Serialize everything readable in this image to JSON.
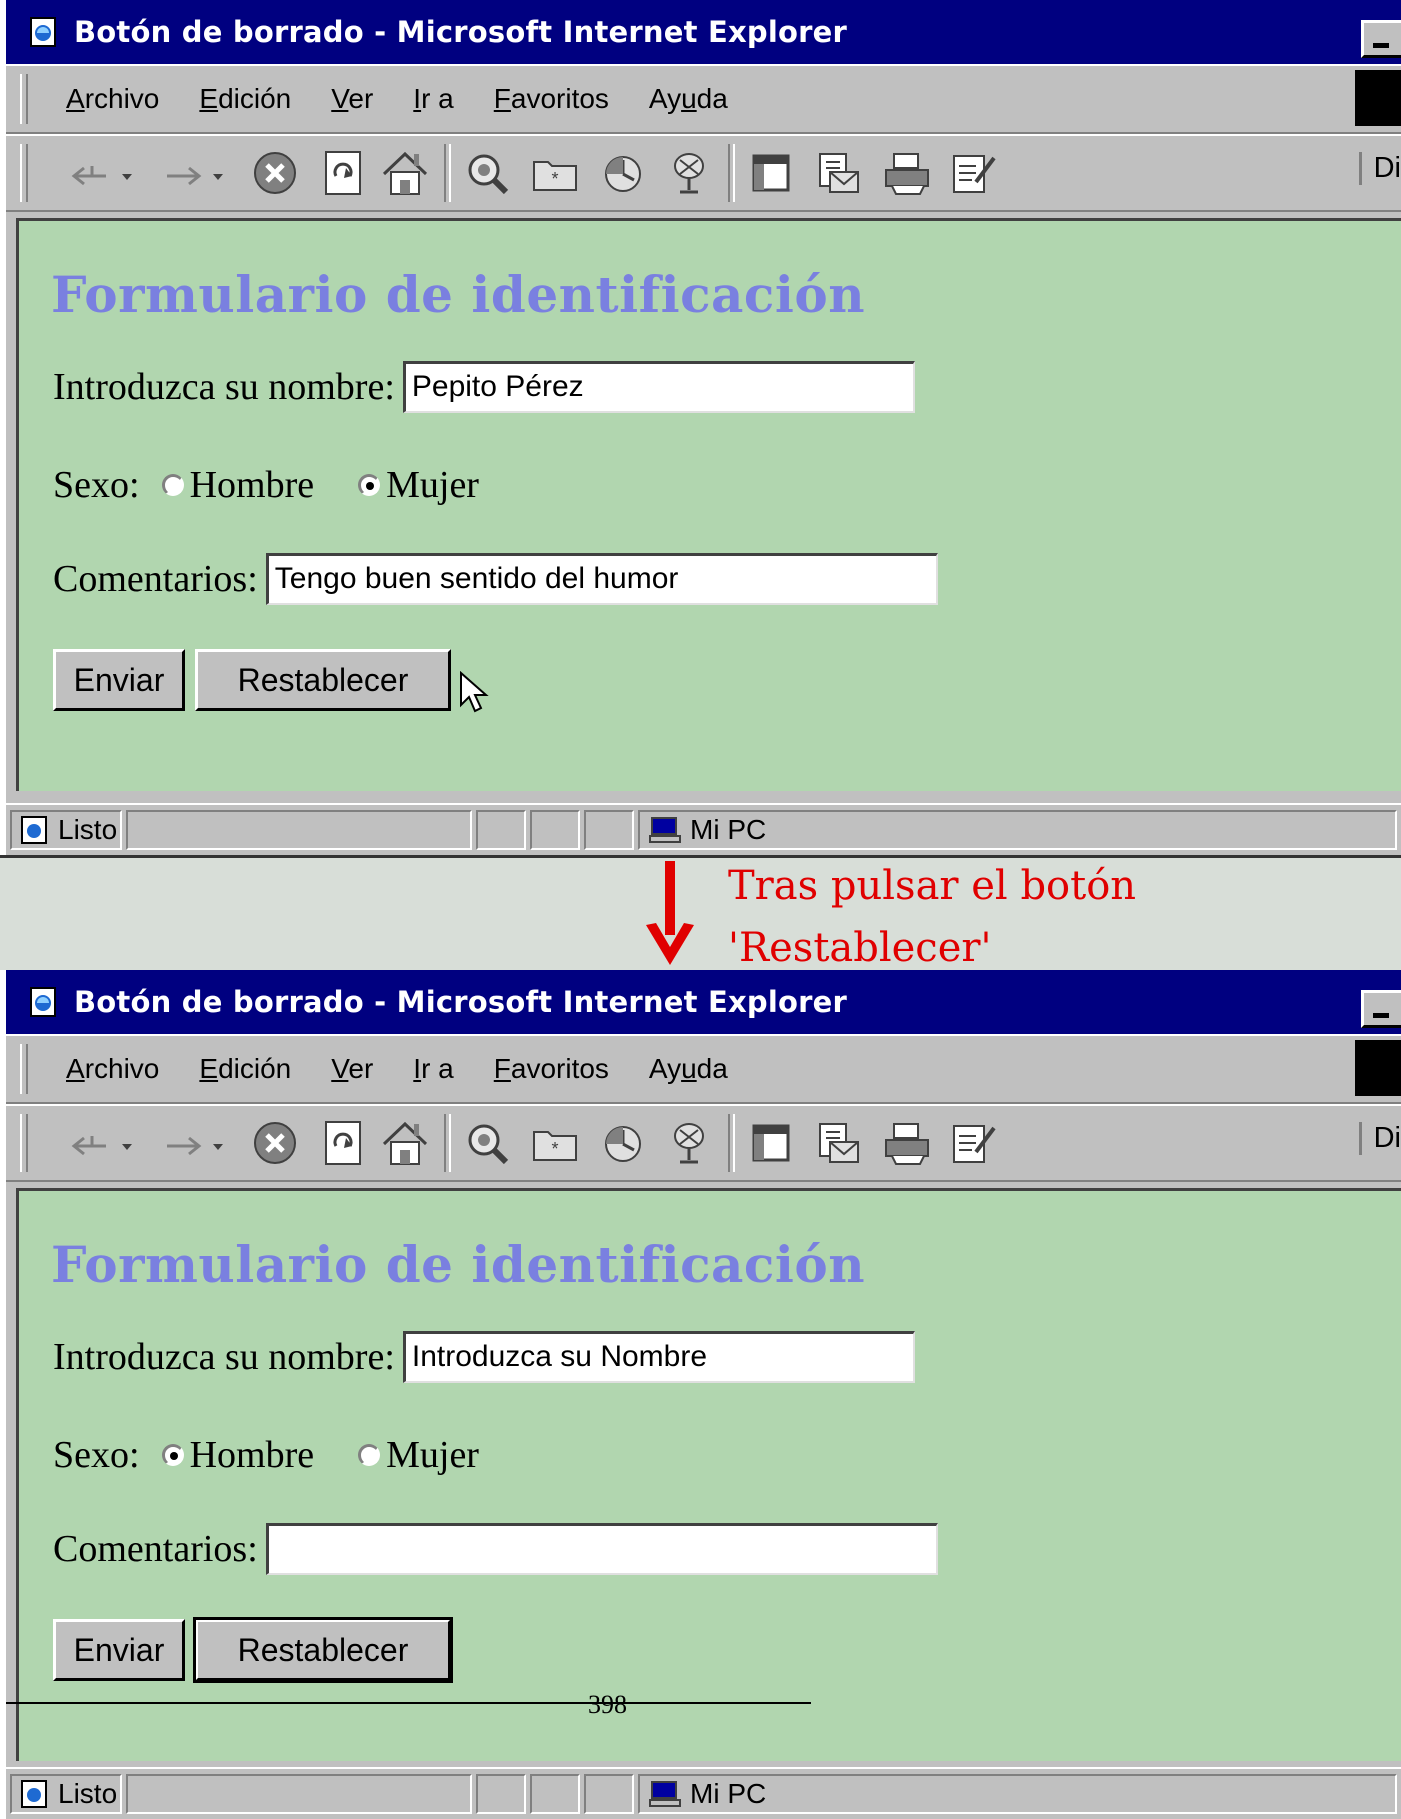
{
  "windows": [
    {
      "title": "Botón de borrado - Microsoft Internet Explorer",
      "menu": {
        "items": [
          {
            "pre": "",
            "accel": "A",
            "post": "rchivo"
          },
          {
            "pre": "",
            "accel": "E",
            "post": "dición"
          },
          {
            "pre": "",
            "accel": "V",
            "post": "er"
          },
          {
            "pre": "",
            "accel": "I",
            "post": "r a"
          },
          {
            "pre": "",
            "accel": "F",
            "post": "avoritos"
          },
          {
            "pre": "Ay",
            "accel": "u",
            "post": "da"
          }
        ]
      },
      "toolbar": {
        "address_label": "Di"
      },
      "form": {
        "heading": "Formulario de identificación",
        "name_label": "Introduzca su nombre:",
        "name_value": "Pepito Pérez",
        "sex_label": "Sexo:",
        "sex_options": [
          "Hombre",
          "Mujer"
        ],
        "sex_selected": "Mujer",
        "comments_label": "Comentarios:",
        "comments_value": "Tengo buen sentido del humor",
        "submit_label": "Enviar",
        "reset_label": "Restablecer"
      },
      "status": {
        "text": "Listo",
        "zone": "Mi PC"
      }
    },
    {
      "title": "Botón de borrado - Microsoft Internet Explorer",
      "menu": {
        "items": [
          {
            "pre": "",
            "accel": "A",
            "post": "rchivo"
          },
          {
            "pre": "",
            "accel": "E",
            "post": "dición"
          },
          {
            "pre": "",
            "accel": "V",
            "post": "er"
          },
          {
            "pre": "",
            "accel": "I",
            "post": "r a"
          },
          {
            "pre": "",
            "accel": "F",
            "post": "avoritos"
          },
          {
            "pre": "Ay",
            "accel": "u",
            "post": "da"
          }
        ]
      },
      "toolbar": {
        "address_label": "Di"
      },
      "form": {
        "heading": "Formulario de identificación",
        "name_label": "Introduzca su nombre:",
        "name_value": "Introduzca su Nombre",
        "sex_label": "Sexo:",
        "sex_options": [
          "Hombre",
          "Mujer"
        ],
        "sex_selected": "Hombre",
        "comments_label": "Comentarios:",
        "comments_value": "",
        "submit_label": "Enviar",
        "reset_label": "Restablecer"
      },
      "status": {
        "text": "Listo",
        "zone": "Mi PC"
      }
    }
  ],
  "annotation": {
    "line1": "Tras pulsar el botón",
    "line2": "'Restablecer'",
    "color": "#e00000"
  },
  "page_number": "398",
  "colors": {
    "titlebar": "#000080",
    "page_background": "#b1d6af",
    "heading": "#7a80e0"
  }
}
